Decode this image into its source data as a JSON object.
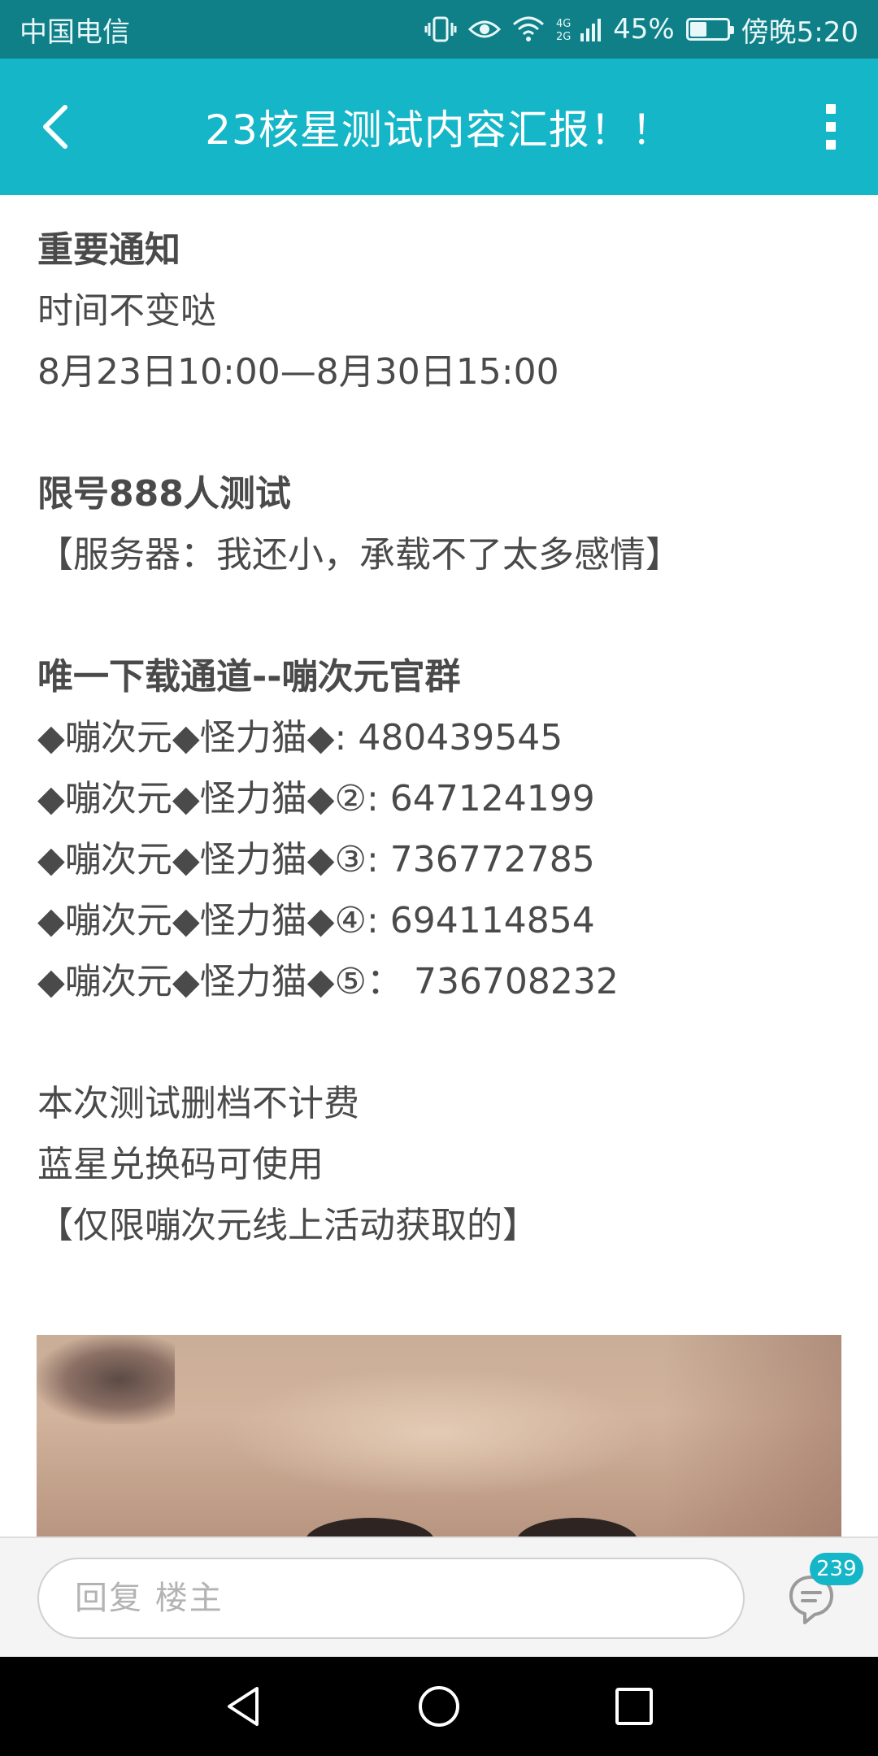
{
  "status_bar": {
    "carrier": "中国电信",
    "network": "4G",
    "battery": "45%",
    "battery_level": 0.45,
    "time": "傍晚5:20",
    "icons": [
      "vibrate-icon",
      "eye-icon",
      "wifi-icon",
      "signal-icon",
      "battery-icon"
    ]
  },
  "app_bar": {
    "title": "23核星测试内容汇报！！",
    "icons": [
      "back-arrow-icon",
      "more-vert-icon"
    ]
  },
  "post": {
    "heading_notice": "重要通知",
    "time_note": "时间不变哒",
    "time_range": "8月23日10:00—8月30日15:00",
    "heading_limit": "限号888人测试",
    "server_note": "【服务器：我还小，承载不了太多感情】",
    "heading_download": "唯一下载通道--嘣次元官群",
    "groups": [
      "◆嘣次元◆怪力猫◆: 480439545",
      "◆嘣次元◆怪力猫◆②: 647124199",
      "◆嘣次元◆怪力猫◆③: 736772785",
      "◆嘣次元◆怪力猫◆④: 694114854",
      "◆嘣次元◆怪力猫◆⑤： 736708232"
    ],
    "wipe_note": "本次测试删档不计费",
    "code_note": "蓝星兑换码可使用",
    "code_limit": "【仅限嘣次元线上活动获取的】"
  },
  "reply": {
    "placeholder": "回复  楼主",
    "comment_count": "239"
  },
  "nav": {
    "icons": [
      "nav-back-icon",
      "nav-home-icon",
      "nav-recents-icon"
    ]
  },
  "colors": {
    "status_bar": "#0f7f88",
    "app_bar": "#15b6c8",
    "text": "#4a4a4a",
    "nav_bar": "#000000"
  }
}
